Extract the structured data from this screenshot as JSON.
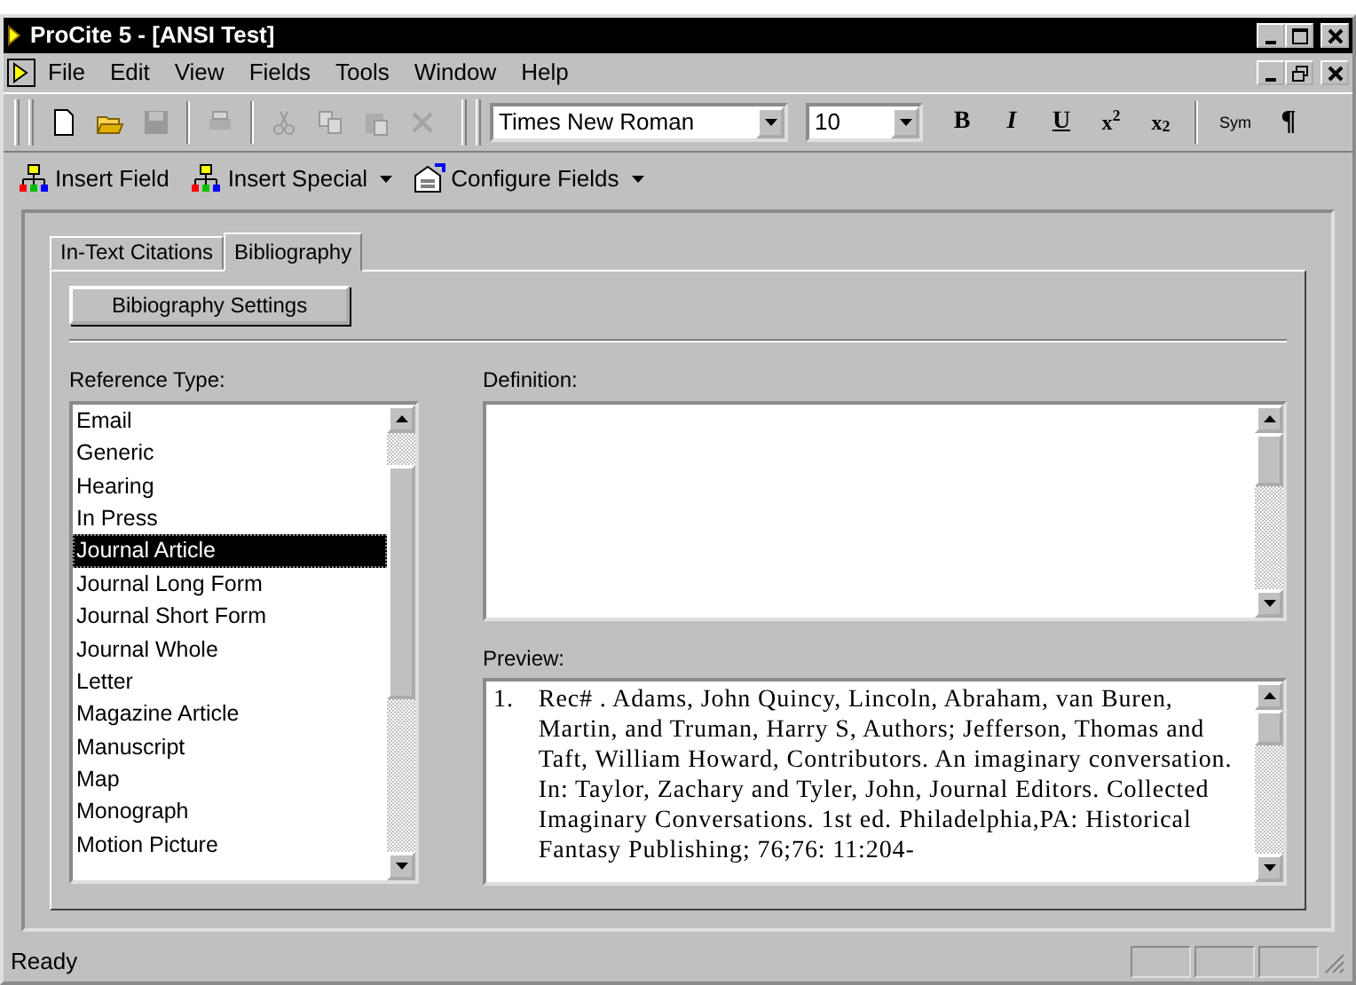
{
  "window": {
    "title": "ProCite 5 - [ANSI Test]"
  },
  "menu": [
    "File",
    "Edit",
    "View",
    "Fields",
    "Tools",
    "Window",
    "Help"
  ],
  "toolbar": {
    "buttons": [
      {
        "kind": "new",
        "disabled": false
      },
      {
        "kind": "open",
        "disabled": false
      },
      {
        "kind": "save",
        "disabled": true
      },
      {
        "kind": "sep"
      },
      {
        "kind": "print",
        "disabled": true
      },
      {
        "kind": "sep"
      },
      {
        "kind": "cut",
        "disabled": true
      },
      {
        "kind": "copy",
        "disabled": true
      },
      {
        "kind": "paste",
        "disabled": true
      },
      {
        "kind": "delete",
        "disabled": true
      }
    ],
    "font": "Times New Roman",
    "size": "10",
    "format": [
      {
        "kind": "bold",
        "label": "B"
      },
      {
        "kind": "italic",
        "label": "I"
      },
      {
        "kind": "underline",
        "label": "U"
      },
      {
        "kind": "sup",
        "label": "x$^{2}$"
      },
      {
        "kind": "sub",
        "label": "x$_{2}$"
      },
      {
        "kind": "sep"
      },
      {
        "kind": "small",
        "label": "Sym"
      },
      {
        "kind": "plain",
        "label": "¶"
      }
    ]
  },
  "fields_toolbar": [
    {
      "label": "Insert Field",
      "dropdown": false
    },
    {
      "label": "Insert Special",
      "dropdown": true
    },
    {
      "label": "Configure Fields",
      "dropdown": true
    }
  ],
  "tabs": [
    {
      "label": "In-Text Citations",
      "selected": false
    },
    {
      "label": "Bibliography",
      "selected": true
    }
  ],
  "settings_button": "Bibiography Settings",
  "reference_type": {
    "label": "Reference Type:",
    "items": [
      {
        "label": "Email",
        "selected": false
      },
      {
        "label": "Generic",
        "selected": false
      },
      {
        "label": "Hearing",
        "selected": false
      },
      {
        "label": "In Press",
        "selected": false
      },
      {
        "label": "Journal Article",
        "selected": true
      },
      {
        "label": "Journal Long Form",
        "selected": false
      },
      {
        "label": "Journal Short Form",
        "selected": false
      },
      {
        "label": "Journal Whole",
        "selected": false
      },
      {
        "label": "Letter",
        "selected": false
      },
      {
        "label": "Magazine Article",
        "selected": false
      },
      {
        "label": "Manuscript",
        "selected": false
      },
      {
        "label": "Map",
        "selected": false
      },
      {
        "label": "Monograph",
        "selected": false
      },
      {
        "label": "Motion Picture",
        "selected": false
      }
    ]
  },
  "definition": {
    "label": "Definition:"
  },
  "preview": {
    "label": "Preview:",
    "number": "1.",
    "text": "Rec# . Adams, John Quincy, Lincoln, Abraham, van Buren, Martin, and Truman, Harry S, Authors; Jefferson, Thomas and Taft, William Howard, Contributors. An imaginary conversation. In: Taylor, Zachary and Tyler, John, Journal Editors. Collected Imaginary Conversations. 1st ed. Philadelphia,PA: Historical Fantasy Publishing; 76;76: 11:204-"
  },
  "status_bar": "Ready"
}
